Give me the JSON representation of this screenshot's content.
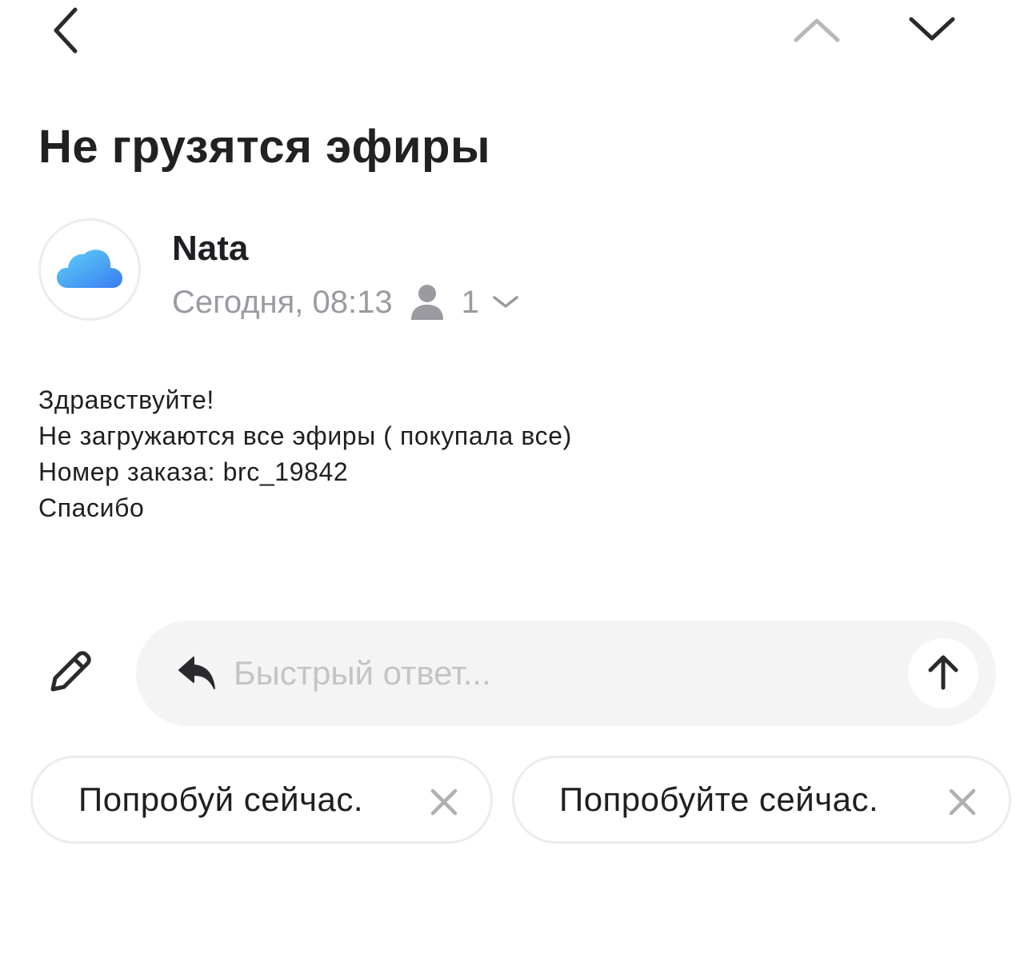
{
  "nav": {
    "back_icon": "chevron-left-icon",
    "prev_icon": "chevron-up-icon",
    "next_icon": "chevron-down-icon"
  },
  "email": {
    "subject": "Не грузятся эфиры",
    "sender_name": "Nata",
    "avatar_icon": "cloud-icon",
    "date": "Сегодня, 08:13",
    "recipients_icon": "person-icon",
    "recipients_count": "1",
    "body_lines": [
      "Здравствуйте!",
      "Не загружаются все эфиры ( покупала все)",
      "Номер заказа: brc_19842",
      "Спасибо"
    ]
  },
  "compose": {
    "icon": "pencil-icon"
  },
  "quick_reply": {
    "placeholder": "Быстрый ответ...",
    "reply_icon": "reply-arrow-icon",
    "send_icon": "arrow-up-icon"
  },
  "suggestions": [
    {
      "label": "Попробуй сейчас.",
      "close_icon": "close-icon"
    },
    {
      "label": "Попробуйте сейчас.",
      "close_icon": "close-icon"
    }
  ],
  "colors": {
    "text_primary": "#1f1f23",
    "text_secondary": "#9a9aa0",
    "placeholder": "#c4c4c8",
    "input_background": "#f4f4f5",
    "border": "#ececee",
    "avatar_gradient_start": "#5ed3f7",
    "avatar_gradient_end": "#3a7cf2"
  }
}
